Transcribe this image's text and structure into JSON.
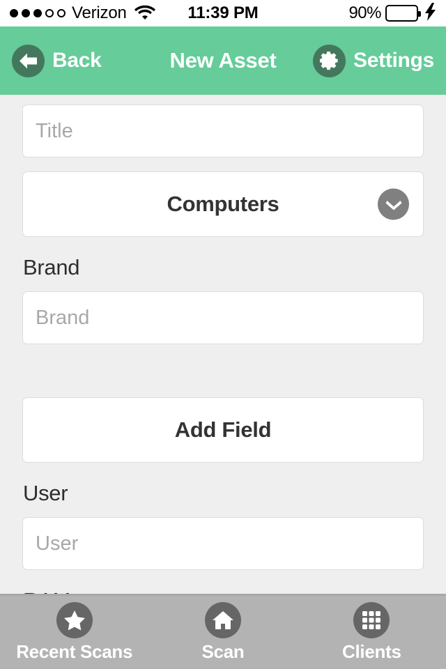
{
  "status_bar": {
    "carrier": "Verizon",
    "signal_dots_filled": 3,
    "signal_dots_total": 5,
    "wifi_icon": "wifi-icon",
    "time": "11:39 PM",
    "battery_percent": "90%",
    "battery_level": 90,
    "battery_fill_color": "#45d261",
    "charging_icon": "lightning-bolt-icon"
  },
  "nav_bar": {
    "background_color": "#65cc9a",
    "icon_circle_color": "#44785e",
    "back_icon": "arrow-left-icon",
    "back_label": "Back",
    "title": "New Asset",
    "settings_icon": "gear-icon",
    "settings_label": "Settings"
  },
  "form": {
    "title_field": {
      "placeholder": "Title",
      "value": ""
    },
    "category_dropdown": {
      "selected": "Computers",
      "chevron_icon": "chevron-down-icon",
      "chevron_circle_color": "#808080"
    },
    "brand_label": "Brand",
    "brand_field": {
      "placeholder": "Brand",
      "value": ""
    },
    "add_field_button": "Add Field",
    "user_label": "User",
    "user_field": {
      "placeholder": "User",
      "value": ""
    },
    "ram_label": "RAM"
  },
  "tab_bar": {
    "background_color": "#b3b3b3",
    "icon_circle_color": "#666666",
    "tabs": [
      {
        "label": "Recent Scans",
        "icon": "star-icon"
      },
      {
        "label": "Scan",
        "icon": "home-icon"
      },
      {
        "label": "Clients",
        "icon": "grid-icon"
      }
    ]
  }
}
